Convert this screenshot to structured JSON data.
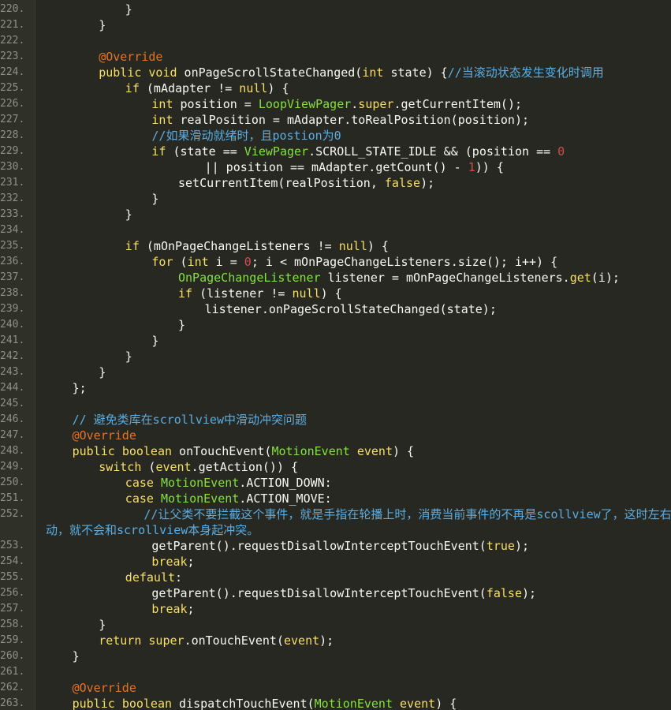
{
  "editor": {
    "theme_colors": {
      "background": "#272822",
      "gutter": "#2f3129",
      "line_number": "#8f908a",
      "text": "#f8f8f2",
      "keyword": "#f9df65",
      "class_name": "#84e23a",
      "number": "#d54a4a",
      "comment": "#5aaee3",
      "annotation": "#e2742a"
    },
    "lines": [
      {
        "n": "220.",
        "indent": 3,
        "tokens": [
          [
            "}",
            "pl"
          ]
        ]
      },
      {
        "n": "221.",
        "indent": 2,
        "tokens": [
          [
            "}",
            "pl"
          ]
        ]
      },
      {
        "n": "222.",
        "indent": 0,
        "tokens": []
      },
      {
        "n": "223.",
        "indent": 2,
        "tokens": [
          [
            "@Override",
            "an"
          ]
        ]
      },
      {
        "n": "224.",
        "indent": 2,
        "tokens": [
          [
            "public",
            "kw"
          ],
          [
            " ",
            "pl"
          ],
          [
            "void",
            "ty"
          ],
          [
            " onPageScrollStateChanged(",
            "pl"
          ],
          [
            "int",
            "ty"
          ],
          [
            " state) {",
            "pl"
          ],
          [
            "//当滚动状态发生变化时调用",
            "cm"
          ]
        ]
      },
      {
        "n": "225.",
        "indent": 3,
        "tokens": [
          [
            "if",
            "kw"
          ],
          [
            " (mAdapter != ",
            "pl"
          ],
          [
            "null",
            "kw"
          ],
          [
            ") {",
            "pl"
          ]
        ]
      },
      {
        "n": "226.",
        "indent": 4,
        "tokens": [
          [
            "int",
            "ty"
          ],
          [
            " position = ",
            "pl"
          ],
          [
            "LoopViewPager",
            "cls"
          ],
          [
            ".",
            "pl"
          ],
          [
            "super",
            "kw"
          ],
          [
            ".getCurrentItem();",
            "pl"
          ]
        ]
      },
      {
        "n": "227.",
        "indent": 4,
        "tokens": [
          [
            "int",
            "ty"
          ],
          [
            " realPosition = mAdapter.toRealPosition(position);",
            "pl"
          ]
        ]
      },
      {
        "n": "228.",
        "indent": 4,
        "tokens": [
          [
            "//如果滑动就绪时，且postion为0",
            "cm"
          ]
        ]
      },
      {
        "n": "229.",
        "indent": 4,
        "tokens": [
          [
            "if",
            "kw"
          ],
          [
            " (state == ",
            "pl"
          ],
          [
            "ViewPager",
            "cls"
          ],
          [
            ".SCROLL_STATE_IDLE && (position == ",
            "pl"
          ],
          [
            "0",
            "num"
          ]
        ]
      },
      {
        "n": "230.",
        "indent": 6,
        "tokens": [
          [
            "|| position == mAdapter.getCount() - ",
            "pl"
          ],
          [
            "1",
            "num"
          ],
          [
            ")) {",
            "pl"
          ]
        ]
      },
      {
        "n": "231.",
        "indent": 5,
        "tokens": [
          [
            "setCurrentItem(realPosition, ",
            "pl"
          ],
          [
            "false",
            "kw"
          ],
          [
            ");",
            "pl"
          ]
        ]
      },
      {
        "n": "232.",
        "indent": 4,
        "tokens": [
          [
            "}",
            "pl"
          ]
        ]
      },
      {
        "n": "233.",
        "indent": 3,
        "tokens": [
          [
            "}",
            "pl"
          ]
        ]
      },
      {
        "n": "234.",
        "indent": 0,
        "tokens": []
      },
      {
        "n": "235.",
        "indent": 3,
        "tokens": [
          [
            "if",
            "kw"
          ],
          [
            " (mOnPageChangeListeners != ",
            "pl"
          ],
          [
            "null",
            "kw"
          ],
          [
            ") {",
            "pl"
          ]
        ]
      },
      {
        "n": "236.",
        "indent": 4,
        "tokens": [
          [
            "for",
            "kw"
          ],
          [
            " (",
            "pl"
          ],
          [
            "int",
            "ty"
          ],
          [
            " i = ",
            "pl"
          ],
          [
            "0",
            "num"
          ],
          [
            "; i < mOnPageChangeListeners.size(); i++) {",
            "pl"
          ]
        ]
      },
      {
        "n": "237.",
        "indent": 5,
        "tokens": [
          [
            "OnPageChangeListener",
            "cls"
          ],
          [
            " listener = mOnPageChangeListeners.",
            "pl"
          ],
          [
            "get",
            "kw"
          ],
          [
            "(i);",
            "pl"
          ]
        ]
      },
      {
        "n": "238.",
        "indent": 5,
        "tokens": [
          [
            "if",
            "kw"
          ],
          [
            " (listener != ",
            "pl"
          ],
          [
            "null",
            "kw"
          ],
          [
            ") {",
            "pl"
          ]
        ]
      },
      {
        "n": "239.",
        "indent": 6,
        "tokens": [
          [
            "listener.onPageScrollStateChanged(state);",
            "pl"
          ]
        ]
      },
      {
        "n": "240.",
        "indent": 5,
        "tokens": [
          [
            "}",
            "pl"
          ]
        ]
      },
      {
        "n": "241.",
        "indent": 4,
        "tokens": [
          [
            "}",
            "pl"
          ]
        ]
      },
      {
        "n": "242.",
        "indent": 3,
        "tokens": [
          [
            "}",
            "pl"
          ]
        ]
      },
      {
        "n": "243.",
        "indent": 2,
        "tokens": [
          [
            "}",
            "pl"
          ]
        ]
      },
      {
        "n": "244.",
        "indent": 1,
        "tokens": [
          [
            "};",
            "pl"
          ]
        ]
      },
      {
        "n": "245.",
        "indent": 0,
        "tokens": []
      },
      {
        "n": "246.",
        "indent": 1,
        "tokens": [
          [
            "// 避免类库在scrollview中滑动冲突问题",
            "cm"
          ]
        ]
      },
      {
        "n": "247.",
        "indent": 1,
        "tokens": [
          [
            "@Override",
            "an"
          ]
        ]
      },
      {
        "n": "248.",
        "indent": 1,
        "tokens": [
          [
            "public",
            "kw"
          ],
          [
            " ",
            "pl"
          ],
          [
            "boolean",
            "ty"
          ],
          [
            " onTouchEvent(",
            "pl"
          ],
          [
            "MotionEvent",
            "cls"
          ],
          [
            " ",
            "pl"
          ],
          [
            "event",
            "kw"
          ],
          [
            ") {",
            "pl"
          ]
        ]
      },
      {
        "n": "249.",
        "indent": 2,
        "tokens": [
          [
            "switch",
            "kw"
          ],
          [
            " (",
            "pl"
          ],
          [
            "event",
            "kw"
          ],
          [
            ".getAction()) {",
            "pl"
          ]
        ]
      },
      {
        "n": "250.",
        "indent": 3,
        "tokens": [
          [
            "case",
            "kw"
          ],
          [
            " ",
            "pl"
          ],
          [
            "MotionEvent",
            "cls"
          ],
          [
            ".ACTION_DOWN:",
            "pl"
          ]
        ]
      },
      {
        "n": "251.",
        "indent": 3,
        "tokens": [
          [
            "case",
            "kw"
          ],
          [
            " ",
            "pl"
          ],
          [
            "MotionEvent",
            "cls"
          ],
          [
            ".ACTION_MOVE:",
            "pl"
          ]
        ]
      },
      {
        "n": "252.",
        "indent": 3.7,
        "tokens": [
          [
            "//让父类不要拦截这个事件，就是手指在轮播上时，消费当前事件的不再是scollview了，这时左右滑",
            "cm"
          ]
        ]
      },
      {
        "n": "",
        "indent": 0,
        "tokens": [
          [
            "动，就不会和scrollview本身起冲突。",
            "cm"
          ]
        ]
      },
      {
        "n": "253.",
        "indent": 4,
        "tokens": [
          [
            "getParent().requestDisallowInterceptTouchEvent(",
            "pl"
          ],
          [
            "true",
            "kw"
          ],
          [
            ");",
            "pl"
          ]
        ]
      },
      {
        "n": "254.",
        "indent": 4,
        "tokens": [
          [
            "break",
            "kw"
          ],
          [
            ";",
            "pl"
          ]
        ]
      },
      {
        "n": "255.",
        "indent": 3,
        "tokens": [
          [
            "default",
            "kw"
          ],
          [
            ":",
            "pl"
          ]
        ]
      },
      {
        "n": "256.",
        "indent": 4,
        "tokens": [
          [
            "getParent().requestDisallowInterceptTouchEvent(",
            "pl"
          ],
          [
            "false",
            "kw"
          ],
          [
            ");",
            "pl"
          ]
        ]
      },
      {
        "n": "257.",
        "indent": 4,
        "tokens": [
          [
            "break",
            "kw"
          ],
          [
            ";",
            "pl"
          ]
        ]
      },
      {
        "n": "258.",
        "indent": 2,
        "tokens": [
          [
            "}",
            "pl"
          ]
        ]
      },
      {
        "n": "259.",
        "indent": 2,
        "tokens": [
          [
            "return",
            "kw"
          ],
          [
            " ",
            "pl"
          ],
          [
            "super",
            "kw"
          ],
          [
            ".onTouchEvent(",
            "pl"
          ],
          [
            "event",
            "kw"
          ],
          [
            ");",
            "pl"
          ]
        ]
      },
      {
        "n": "260.",
        "indent": 1,
        "tokens": [
          [
            "}",
            "pl"
          ]
        ]
      },
      {
        "n": "261.",
        "indent": 0,
        "tokens": []
      },
      {
        "n": "262.",
        "indent": 1,
        "tokens": [
          [
            "@Override",
            "an"
          ]
        ]
      },
      {
        "n": "263.",
        "indent": 1,
        "tokens": [
          [
            "public",
            "kw"
          ],
          [
            " ",
            "pl"
          ],
          [
            "boolean",
            "ty"
          ],
          [
            " dispatchTouchEvent(",
            "pl"
          ],
          [
            "MotionEvent",
            "cls"
          ],
          [
            " ",
            "pl"
          ],
          [
            "event",
            "kw"
          ],
          [
            ") {",
            "pl"
          ]
        ]
      }
    ]
  }
}
